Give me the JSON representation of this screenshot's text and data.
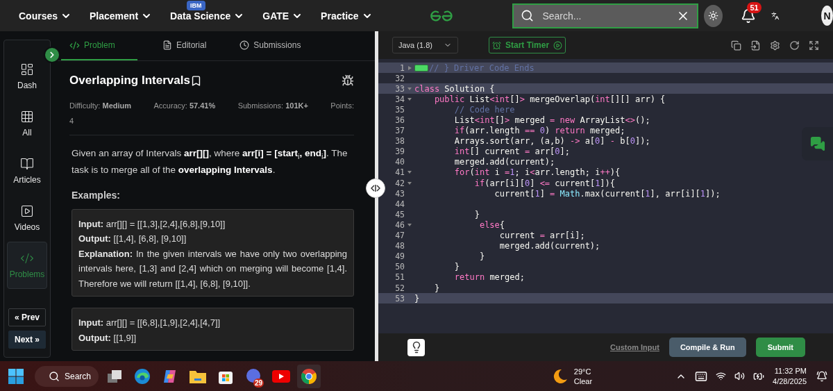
{
  "top_nav": {
    "menus": [
      {
        "label": "Courses"
      },
      {
        "label": "Placement"
      },
      {
        "label": "Data Science",
        "badge": "IBM"
      },
      {
        "label": "GATE"
      },
      {
        "label": "Practice"
      }
    ],
    "search": {
      "placeholder": "Search..."
    },
    "notification_count": "51",
    "avatar_initial": "N"
  },
  "sidebar": {
    "items": [
      {
        "label": "Dash",
        "selected": false
      },
      {
        "label": "All",
        "selected": false
      },
      {
        "label": "Articles",
        "selected": false
      },
      {
        "label": "Videos",
        "selected": false
      },
      {
        "label": "Problems",
        "selected": true
      }
    ],
    "prev": "« Prev",
    "next": "Next »"
  },
  "problem_tabs": [
    {
      "label": "Problem",
      "selected": true
    },
    {
      "label": "Editorial",
      "selected": false
    },
    {
      "label": "Submissions",
      "selected": false
    }
  ],
  "problem": {
    "title": "Overlapping Intervals",
    "stats": [
      {
        "label": "Difficulty:",
        "value": "Medium"
      },
      {
        "label": "Accuracy:",
        "value": "57.41%"
      },
      {
        "label": "Submissions:",
        "value": "101K+"
      }
    ],
    "points": {
      "label": "Points:",
      "value": "4"
    },
    "description": "Given an array of Intervals **arr[][]**, where **arr[i] = [start**$_{i}$**, end**$_{i}$**]**. The task is to merge all of the **overlapping Intervals**.",
    "examples_heading": "Examples:",
    "examples": [
      {
        "lines": [
          {
            "label": "Input:",
            "text": "arr[][]  =  [[1,3],[2,4],[6,8],[9,10]]"
          },
          {
            "label": "Output:",
            "text": "[[1,4],  [6,8],  [9,10]]"
          },
          {
            "label": "Explanation:",
            "text": "In the given intervals we have only two overlapping intervals here, [1,3] and [2,4] which on merging will become [1,4]. Therefore we will return [[1,4],  [6,8],  [9,10]]."
          }
        ]
      },
      {
        "lines": [
          {
            "label": "Input:",
            "text": "arr[][]  =  [[6,8],[1,9],[2,4],[4,7]]"
          },
          {
            "label": "Output:",
            "text": "[[1,9]]"
          }
        ]
      }
    ]
  },
  "editor": {
    "language": "Java (1.8)",
    "timer": "Start Timer",
    "lines": [
      {
        "number": "1",
        "collapsed": true,
        "highlighted": true,
        "tokens": [
          {
            "kind": "cm",
            "text": "// } Driver Code Ends"
          }
        ]
      },
      {
        "number": "32",
        "highlighted": false
      },
      {
        "number": "33",
        "collapsed": false,
        "highlighted": true,
        "tokens": [
          {
            "kind": "kw",
            "text": "class"
          },
          {
            "kind": "plain",
            "text": " Solution {"
          }
        ]
      },
      {
        "number": "34",
        "collapsed": false,
        "highlighted": false,
        "tokens": [
          {
            "kind": "kw",
            "text": "    public"
          },
          {
            "kind": "plain",
            "text": " List"
          },
          {
            "kind": "op",
            "text": "<"
          },
          {
            "kind": "kw",
            "text": "int"
          },
          {
            "kind": "plain",
            "text": "[]"
          },
          {
            "kind": "op",
            "text": ">"
          },
          {
            "kind": "plain",
            "text": " mergeOverlap("
          },
          {
            "kind": "kw",
            "text": "int"
          },
          {
            "kind": "plain",
            "text": "[][] arr) {"
          }
        ]
      },
      {
        "number": "35",
        "highlighted": false,
        "tokens": [
          {
            "kind": "cm",
            "text": "        // Code here"
          }
        ]
      },
      {
        "number": "36",
        "highlighted": false,
        "tokens": [
          {
            "kind": "plain",
            "text": "        List"
          },
          {
            "kind": "op",
            "text": "<"
          },
          {
            "kind": "kw",
            "text": "int"
          },
          {
            "kind": "plain",
            "text": "[]"
          },
          {
            "kind": "op",
            "text": ">"
          },
          {
            "kind": "plain",
            "text": " merged "
          },
          {
            "kind": "op",
            "text": "= "
          },
          {
            "kind": "kw",
            "text": "new"
          },
          {
            "kind": "plain",
            "text": " ArrayList"
          },
          {
            "kind": "op",
            "text": "<>"
          },
          {
            "kind": "plain",
            "text": "();"
          }
        ]
      },
      {
        "number": "37",
        "highlighted": false,
        "tokens": [
          {
            "kind": "kw",
            "text": "        if"
          },
          {
            "kind": "plain",
            "text": "(arr.length "
          },
          {
            "kind": "op",
            "text": "== "
          },
          {
            "kind": "num",
            "text": "0"
          },
          {
            "kind": "plain",
            "text": ") "
          },
          {
            "kind": "kw",
            "text": "return"
          },
          {
            "kind": "plain",
            "text": " merged;"
          }
        ]
      },
      {
        "number": "38",
        "highlighted": false,
        "tokens": [
          {
            "kind": "plain",
            "text": "        Arrays.sort(arr, (a,b) "
          },
          {
            "kind": "op",
            "text": "->"
          },
          {
            "kind": "plain",
            "text": " a["
          },
          {
            "kind": "num",
            "text": "0"
          },
          {
            "kind": "plain",
            "text": "] "
          },
          {
            "kind": "op",
            "text": "-"
          },
          {
            "kind": "plain",
            "text": " b["
          },
          {
            "kind": "num",
            "text": "0"
          },
          {
            "kind": "plain",
            "text": "]);"
          }
        ]
      },
      {
        "number": "39",
        "highlighted": false,
        "tokens": [
          {
            "kind": "kw",
            "text": "        int"
          },
          {
            "kind": "plain",
            "text": "[] current "
          },
          {
            "kind": "op",
            "text": "="
          },
          {
            "kind": "plain",
            "text": " arr["
          },
          {
            "kind": "num",
            "text": "0"
          },
          {
            "kind": "plain",
            "text": "];"
          }
        ]
      },
      {
        "number": "40",
        "highlighted": false,
        "tokens": [
          {
            "kind": "plain",
            "text": "        merged.add(current);"
          }
        ]
      },
      {
        "number": "41",
        "collapsed": false,
        "highlighted": false,
        "tokens": [
          {
            "kind": "kw",
            "text": "        for"
          },
          {
            "kind": "plain",
            "text": "("
          },
          {
            "kind": "kw",
            "text": "int"
          },
          {
            "kind": "plain",
            "text": " i "
          },
          {
            "kind": "op",
            "text": "="
          },
          {
            "kind": "num",
            "text": "1"
          },
          {
            "kind": "plain",
            "text": "; i"
          },
          {
            "kind": "op",
            "text": "<"
          },
          {
            "kind": "plain",
            "text": "arr.length; i"
          },
          {
            "kind": "op",
            "text": "++"
          },
          {
            "kind": "plain",
            "text": "){"
          }
        ]
      },
      {
        "number": "42",
        "collapsed": false,
        "highlighted": false,
        "tokens": [
          {
            "kind": "kw",
            "text": "            if"
          },
          {
            "kind": "plain",
            "text": "(arr[i]["
          },
          {
            "kind": "num",
            "text": "0"
          },
          {
            "kind": "plain",
            "text": "] "
          },
          {
            "kind": "op",
            "text": "<="
          },
          {
            "kind": "plain",
            "text": " current["
          },
          {
            "kind": "num",
            "text": "1"
          },
          {
            "kind": "plain",
            "text": "]){"
          }
        ]
      },
      {
        "number": "43",
        "highlighted": false,
        "tokens": [
          {
            "kind": "plain",
            "text": "                current["
          },
          {
            "kind": "num",
            "text": "1"
          },
          {
            "kind": "plain",
            "text": "] "
          },
          {
            "kind": "op",
            "text": "= "
          },
          {
            "kind": "type",
            "text": "Math"
          },
          {
            "kind": "plain",
            "text": ".max(current["
          },
          {
            "kind": "num",
            "text": "1"
          },
          {
            "kind": "plain",
            "text": "], arr[i]["
          },
          {
            "kind": "num",
            "text": "1"
          },
          {
            "kind": "plain",
            "text": "]);"
          }
        ]
      },
      {
        "number": "44",
        "highlighted": false
      },
      {
        "number": "45",
        "highlighted": false,
        "tokens": [
          {
            "kind": "plain",
            "text": "            }"
          }
        ]
      },
      {
        "number": "46",
        "collapsed": false,
        "highlighted": false,
        "tokens": [
          {
            "kind": "kw",
            "text": "             else"
          },
          {
            "kind": "plain",
            "text": "{"
          }
        ]
      },
      {
        "number": "47",
        "highlighted": false,
        "tokens": [
          {
            "kind": "plain",
            "text": "                 current "
          },
          {
            "kind": "op",
            "text": "="
          },
          {
            "kind": "plain",
            "text": " arr[i];"
          }
        ]
      },
      {
        "number": "48",
        "highlighted": false,
        "tokens": [
          {
            "kind": "plain",
            "text": "                 merged.add(current);"
          }
        ]
      },
      {
        "number": "49",
        "highlighted": false,
        "tokens": [
          {
            "kind": "plain",
            "text": "             }"
          }
        ]
      },
      {
        "number": "50",
        "highlighted": false,
        "tokens": [
          {
            "kind": "plain",
            "text": "        }"
          }
        ]
      },
      {
        "number": "51",
        "highlighted": false,
        "tokens": [
          {
            "kind": "kw",
            "text": "        return"
          },
          {
            "kind": "plain",
            "text": " merged;"
          }
        ]
      },
      {
        "number": "52",
        "highlighted": false,
        "tokens": [
          {
            "kind": "plain",
            "text": "    }"
          }
        ]
      },
      {
        "number": "53",
        "highlighted": true,
        "tokens": [
          {
            "kind": "plain",
            "text": "}"
          }
        ]
      }
    ],
    "custom_input": "Custom Input",
    "compile_button": "Compile & Run",
    "submit_button": "Submit"
  },
  "taskbar": {
    "search": "Search",
    "calendar_badge": "29",
    "weather": {
      "temperature": "29°C",
      "condition": "Clear"
    },
    "time": "11:32 PM",
    "date": "4/28/2025"
  }
}
